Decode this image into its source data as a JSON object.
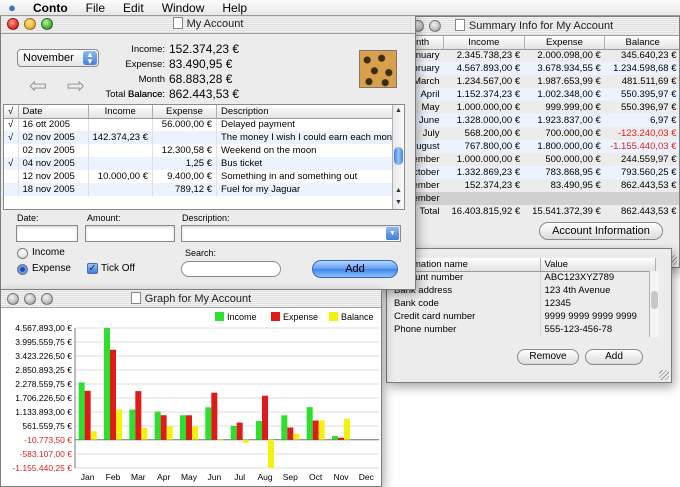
{
  "menubar": {
    "app": "Conto",
    "items": [
      "File",
      "Edit",
      "Window",
      "Help"
    ]
  },
  "summary": {
    "title": "Summary Info for My Account",
    "columns": [
      "Month",
      "Income",
      "Expense",
      "Balance"
    ],
    "rows": [
      {
        "month": "January",
        "income": "2.345.738,23 €",
        "expense": "2.000.098,00 €",
        "balance": "345.640,23 €",
        "neg": false
      },
      {
        "month": "February",
        "income": "4.567.893,00 €",
        "expense": "3.678.934,55 €",
        "balance": "1.234.598,68 €",
        "neg": false
      },
      {
        "month": "March",
        "income": "1.234.567,00 €",
        "expense": "1.987.653,99 €",
        "balance": "481.511,69 €",
        "neg": false
      },
      {
        "month": "April",
        "income": "1.152.374,23 €",
        "expense": "1.002.348,00 €",
        "balance": "550.395,97 €",
        "neg": false
      },
      {
        "month": "May",
        "income": "1.000.000,00 €",
        "expense": "999.999,00 €",
        "balance": "550.396,97 €",
        "neg": false
      },
      {
        "month": "June",
        "income": "1.328.000,00 €",
        "expense": "1.923.837,00 €",
        "balance": "6,97 €",
        "neg": false
      },
      {
        "month": "July",
        "income": "568.200,00 €",
        "expense": "700.000,00 €",
        "balance": "-123.240,03 €",
        "neg": true
      },
      {
        "month": "August",
        "income": "767.800,00 €",
        "expense": "1.800.000,00 €",
        "balance": "-1.155.440,03 €",
        "neg": true
      },
      {
        "month": "September",
        "income": "1.000.000,00 €",
        "expense": "500.000,00 €",
        "balance": "244.559,97 €",
        "neg": false
      },
      {
        "month": "October",
        "income": "1.332.869,23 €",
        "expense": "783.868,95 €",
        "balance": "793.560,25 €",
        "neg": false
      },
      {
        "month": "November",
        "income": "152.374,23 €",
        "expense": "83.490,95 €",
        "balance": "862.443,53 €",
        "neg": false
      },
      {
        "month": "December",
        "income": "",
        "expense": "",
        "balance": "",
        "neg": false,
        "selected": true
      },
      {
        "month": "Total",
        "income": "16.403.815,92 €",
        "expense": "15.541.372,39 €",
        "balance": "862.443,53 €",
        "neg": false
      }
    ],
    "account_info_button": "Account Information"
  },
  "account_info": {
    "columns": [
      "Information name",
      "Value"
    ],
    "rows": [
      {
        "name": "Account number",
        "value": "ABC123XYZ789"
      },
      {
        "name": "Bank address",
        "value": "123 4th Avenue"
      },
      {
        "name": "Bank code",
        "value": "12345"
      },
      {
        "name": "Credit card number",
        "value": "9999 9999 9999 9999"
      },
      {
        "name": "Phone number",
        "value": "555-123-456-78"
      }
    ],
    "remove_label": "Remove",
    "add_label": "Add"
  },
  "account": {
    "title": "My Account",
    "month": "November",
    "income_label": "Income:",
    "income": "152.374,23 €",
    "expense_label": "Expense:",
    "expense": "83.490,95 €",
    "month_balance_label": "Month Balance:",
    "month_balance": "68.883,28 €",
    "total_balance_label": "Total Balance:",
    "total_balance": "862.443,53 €",
    "columns": [
      "√",
      "Date",
      "Income",
      "Expense",
      "Description"
    ],
    "transactions": [
      {
        "check": "√",
        "date": "16 ott 2005",
        "income": "",
        "expense": "56.000,00 €",
        "description": "Delayed payment"
      },
      {
        "check": "√",
        "date": "02 nov 2005",
        "income": "142.374,23 €",
        "expense": "",
        "description": "The money I wish I could earn each month"
      },
      {
        "check": "",
        "date": "02 nov 2005",
        "income": "",
        "expense": "12.300,58 €",
        "description": "Weekend on the moon"
      },
      {
        "check": "√",
        "date": "04 nov 2005",
        "income": "",
        "expense": "1,25 €",
        "description": "Bus ticket"
      },
      {
        "check": "",
        "date": "12 nov 2005",
        "income": "10.000,00 €",
        "expense": "9.400,00 €",
        "description": "Something in and something out"
      },
      {
        "check": "",
        "date": "18 nov 2005",
        "income": "",
        "expense": "789,12 €",
        "description": "Fuel for my Jaguar"
      }
    ],
    "form": {
      "date_label": "Date:",
      "amount_label": "Amount:",
      "description_label": "Description:",
      "income_option": "Income",
      "expense_option": "Expense",
      "selected_option": "Expense",
      "tick_off_label": "Tick Off",
      "tick_off_checked": true,
      "search_label": "Search:",
      "search_value": "",
      "add_label": "Add"
    }
  },
  "graph": {
    "title": "Graph for My Account",
    "colors": {
      "income": "#2ee02e",
      "expense": "#e01a1a",
      "balance": "#f2f20e"
    }
  },
  "chart_data": {
    "type": "bar",
    "categories": [
      "Jan",
      "Feb",
      "Mar",
      "Apr",
      "May",
      "Jun",
      "Jul",
      "Aug",
      "Sep",
      "Oct",
      "Nov",
      "Dec"
    ],
    "series": [
      {
        "name": "Income",
        "values": [
          2345738.23,
          4567893.0,
          1234567.0,
          1152374.23,
          1000000.0,
          1328000.0,
          568200.0,
          767800.0,
          1000000.0,
          1332869.23,
          152374.23,
          0
        ]
      },
      {
        "name": "Expense",
        "values": [
          2000098.0,
          3678934.55,
          1987653.99,
          1002348.0,
          999999.0,
          1923837.0,
          700000.0,
          1800000.0,
          500000.0,
          783868.95,
          83490.95,
          0
        ]
      },
      {
        "name": "Balance",
        "values": [
          345640.23,
          1234598.68,
          481511.69,
          550395.97,
          550396.97,
          6.97,
          -123240.03,
          -1155440.03,
          244559.97,
          793560.25,
          862443.53,
          0
        ]
      }
    ],
    "yticks": [
      "4.567.893,00 €",
      "3.995.559,75 €",
      "3.423.226,50 €",
      "2.850.893,25 €",
      "2.278.559,75 €",
      "1.706.226,50 €",
      "1.133.893,00 €",
      "561.559,75 €",
      "-10.773,50 €",
      "-583.107,00 €",
      "-1.155.440,25 €"
    ],
    "ylim": [
      -1155440.25,
      4567893.0
    ],
    "legend": "top-right",
    "grid": true
  }
}
